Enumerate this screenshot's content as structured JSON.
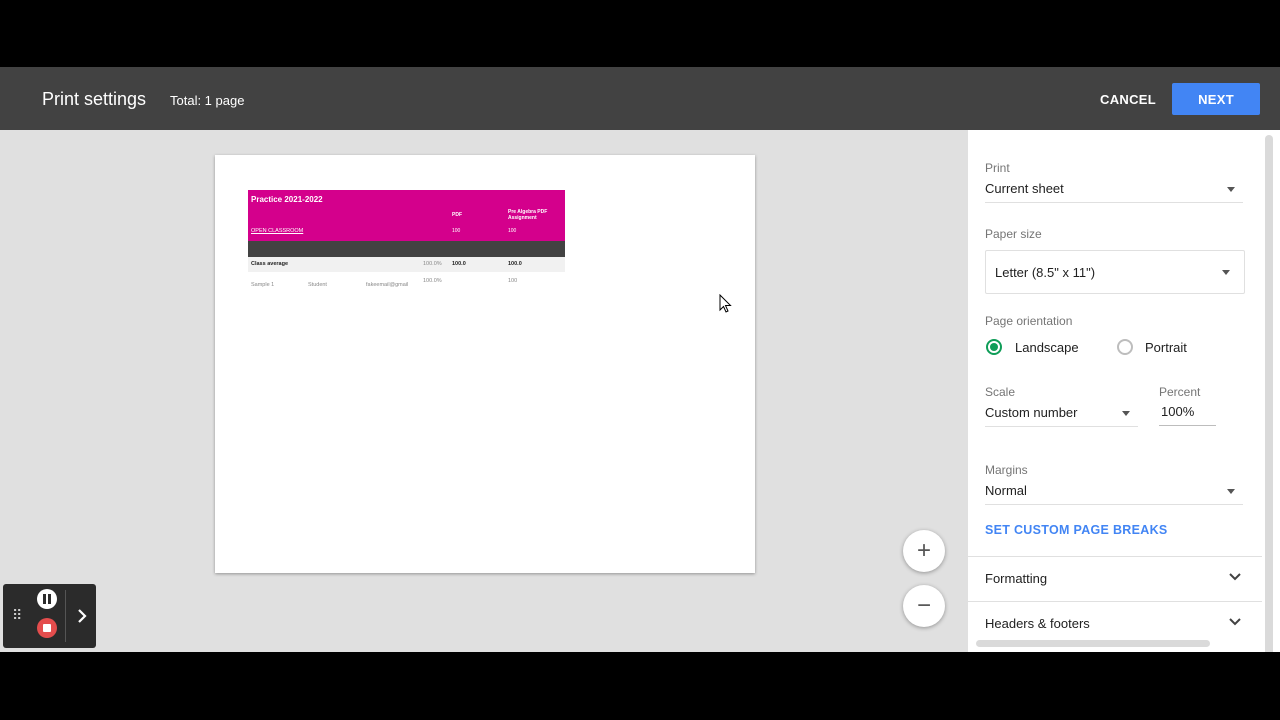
{
  "header": {
    "title": "Print settings",
    "total": "Total: 1 page",
    "cancel_label": "CANCEL",
    "next_label": "NEXT"
  },
  "preview": {
    "sheet": {
      "title": "Practice 2021-2022",
      "col_pdf": "PDF",
      "col_prealgebra": "Pre Algebra PDF Assignment",
      "link": "OPEN CLASSROOM",
      "points_pdf": "100",
      "points_prealgebra": "100",
      "avg_label": "Class average",
      "avg_pct": "100.0%",
      "avg_pdf": "100.0",
      "avg_prealgebra": "100.0",
      "student_first": "Sample 1",
      "student_last": "Student",
      "student_email": "fakeemail@gmail",
      "student_pct": "100.0%",
      "student_prealgebra": "100"
    },
    "zoom_in": "+",
    "zoom_out": "−"
  },
  "settings": {
    "print_label": "Print",
    "print_value": "Current sheet",
    "paper_label": "Paper size",
    "paper_value": "Letter (8.5\" x 11\")",
    "orientation_label": "Page orientation",
    "landscape_label": "Landscape",
    "portrait_label": "Portrait",
    "orientation_selected": "Landscape",
    "scale_label": "Scale",
    "scale_value": "Custom number",
    "percent_label": "Percent",
    "percent_value": "100%",
    "margins_label": "Margins",
    "margins_value": "Normal",
    "custom_breaks_label": "SET CUSTOM PAGE BREAKS",
    "formatting_label": "Formatting",
    "headers_footers_label": "Headers & footers"
  },
  "colors": {
    "header_bg": "#424242",
    "accent": "#4285f4",
    "sheet_header": "#d4008c",
    "radio_selected": "#0f9d58"
  }
}
